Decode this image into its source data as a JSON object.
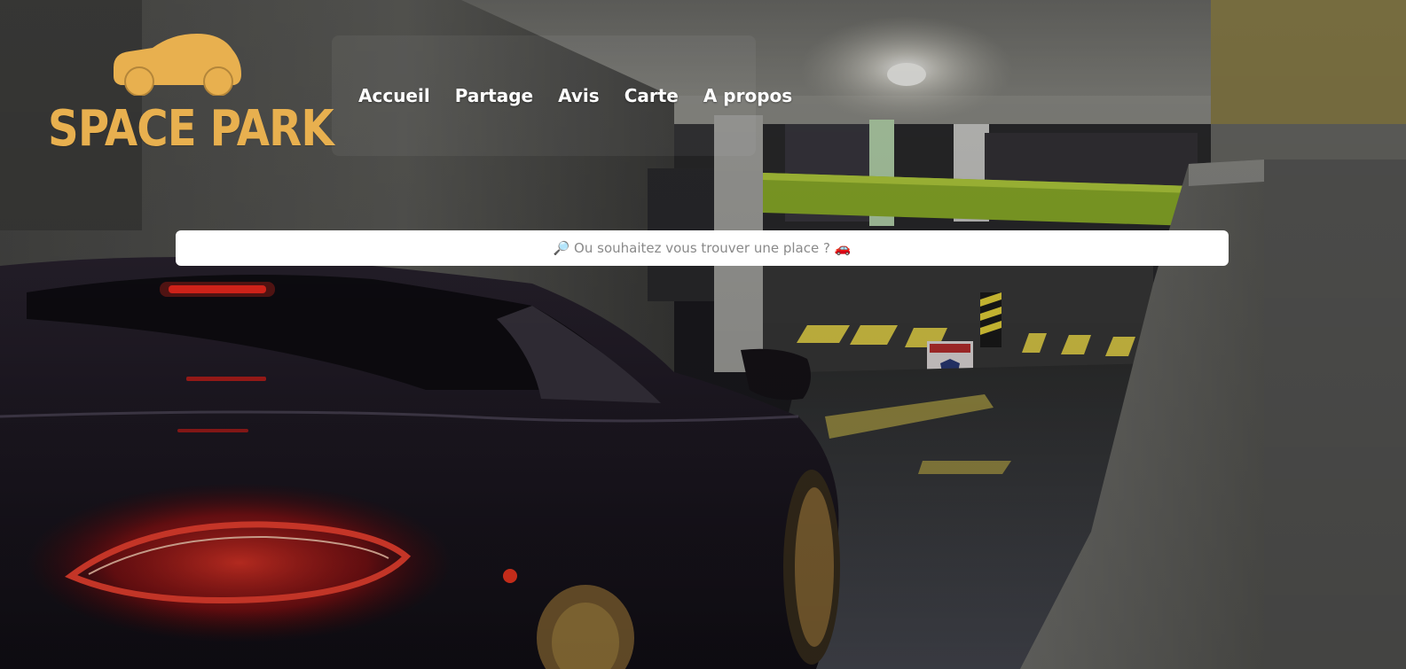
{
  "brand": {
    "name": "SPACE PARK",
    "logo_icon": "car-icon",
    "accent_color": "#e8b04f"
  },
  "nav": {
    "items": [
      {
        "label": "Accueil"
      },
      {
        "label": "Partage"
      },
      {
        "label": "Avis"
      },
      {
        "label": "Carte"
      },
      {
        "label": "A propos"
      }
    ]
  },
  "search": {
    "placeholder": "🔎 Ou souhaitez vous trouver une place ? 🚗"
  },
  "hero": {
    "background": "parking-garage-sports-car-photo"
  }
}
